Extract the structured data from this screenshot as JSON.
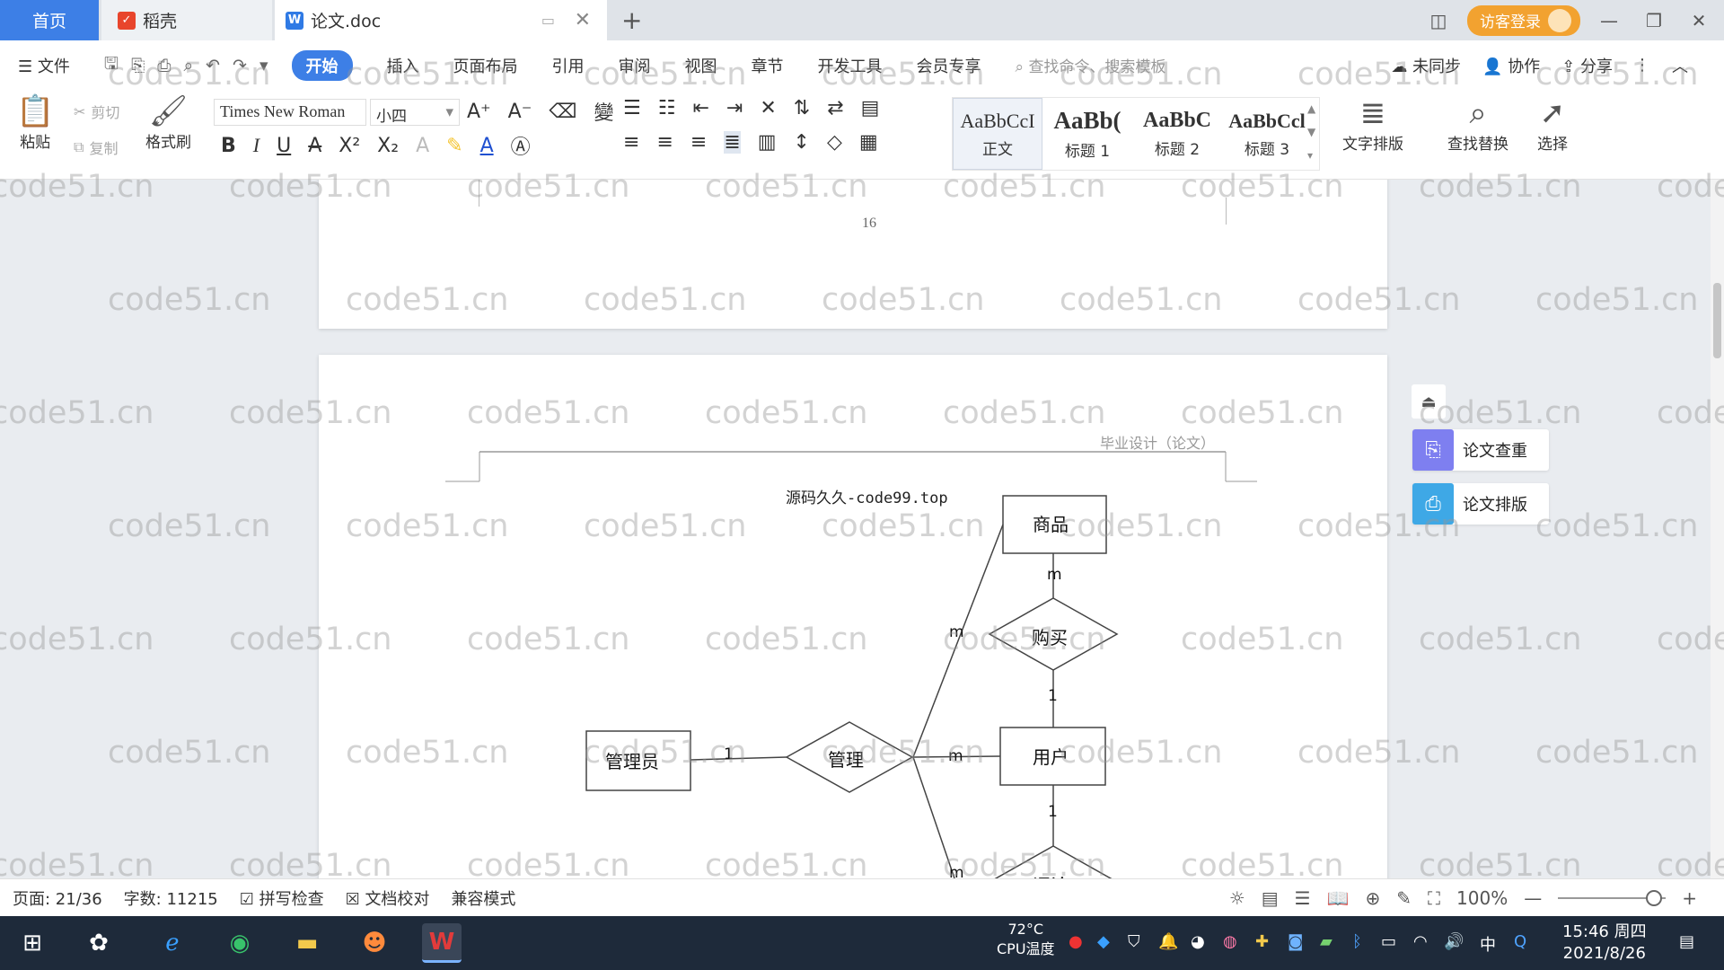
{
  "tabs": {
    "home": "首页",
    "daoke": "稻壳",
    "doc": "论文.doc",
    "add": "+"
  },
  "titlebar": {
    "visitor_login": "访客登录"
  },
  "menu": {
    "file": "文件",
    "items": [
      "开始",
      "插入",
      "页面布局",
      "引用",
      "审阅",
      "视图",
      "章节",
      "开发工具",
      "会员专享"
    ],
    "search_placeholder": "查找命令、搜索模板",
    "sync": "未同步",
    "collab": "协作",
    "share": "分享"
  },
  "ribbon": {
    "paste": "粘贴",
    "cut": "剪切",
    "copy": "复制",
    "format_painter": "格式刷",
    "font_name": "Times New Roman",
    "font_size": "小四",
    "styles": [
      {
        "sample": "AaBbCcI",
        "name": "正文"
      },
      {
        "sample": "AaBb(",
        "name": "标题 1"
      },
      {
        "sample": "AaBbC",
        "name": "标题 2"
      },
      {
        "sample": "AaBbCcl",
        "name": "标题 3"
      }
    ],
    "text_layout": "文字排版",
    "find_replace": "查找替换",
    "select": "选择"
  },
  "document": {
    "page_number": "16",
    "header_text": "毕业设计（论文）",
    "source_text": "源码久久-code99.top",
    "watermark": "code51.cn"
  },
  "er_diagram": {
    "entities": {
      "goods": "商品",
      "user": "用户",
      "admin": "管理员"
    },
    "relationships": {
      "buy": "购买",
      "manage": "管理",
      "partial": "评论"
    },
    "cardinalities": {
      "goods_buy": "m",
      "buy_user": "1",
      "manage_goods": "m",
      "admin_manage": "1",
      "manage_user": "m",
      "user_below": "1",
      "manage_below": "m"
    }
  },
  "side_panel": {
    "check": "论文查重",
    "layout": "论文排版"
  },
  "status": {
    "page": "页面: 21/36",
    "words": "字数: 11215",
    "spell": "拼写检查",
    "proof": "文档校对",
    "compat": "兼容模式",
    "zoom": "100%"
  },
  "taskbar": {
    "cpu_temp": "72°C",
    "cpu_label": "CPU温度",
    "ime": "中",
    "time": "15:46 周四",
    "date": "2021/8/26"
  }
}
